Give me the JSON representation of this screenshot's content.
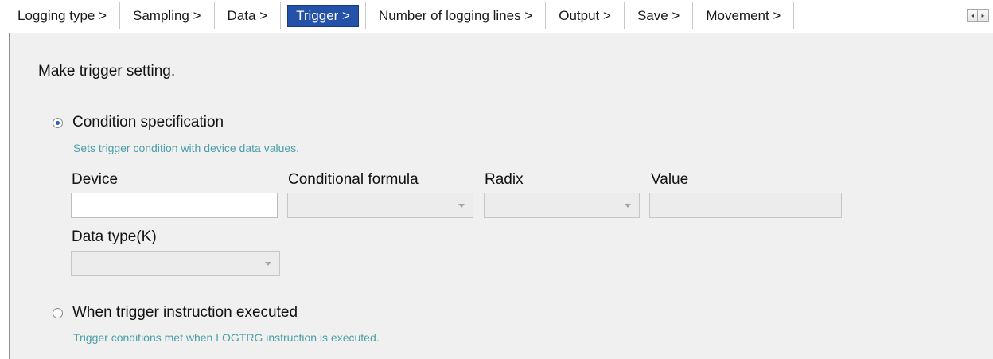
{
  "tabs": [
    {
      "label": "Logging type >"
    },
    {
      "label": "Sampling >"
    },
    {
      "label": "Data >"
    },
    {
      "label": "Trigger >",
      "selected": true
    },
    {
      "label": "Number of logging lines >"
    },
    {
      "label": "Output >"
    },
    {
      "label": "Save >"
    },
    {
      "label": "Movement >"
    }
  ],
  "scroll_buttons": {
    "left_icon": "◂",
    "right_icon": "▸"
  },
  "panel": {
    "heading": "Make trigger setting.",
    "condition": {
      "label": "Condition specification",
      "hint": "Sets trigger condition with device data values.",
      "selected": true,
      "fields": {
        "device_label": "Device",
        "device_value": "",
        "formula_label": "Conditional formula",
        "formula_value": "",
        "radix_label": "Radix",
        "radix_value": "",
        "value_label": "Value",
        "value_value": "",
        "datatype_label": "Data type(K)",
        "datatype_value": ""
      }
    },
    "instruction": {
      "label": "When trigger instruction executed",
      "hint": "Trigger conditions met when LOGTRG instruction is executed.",
      "selected": false
    }
  },
  "colors": {
    "selected_tab": "#2452a8",
    "panel_bg": "#f0f0f0",
    "hint_text": "#4a9fa6"
  }
}
